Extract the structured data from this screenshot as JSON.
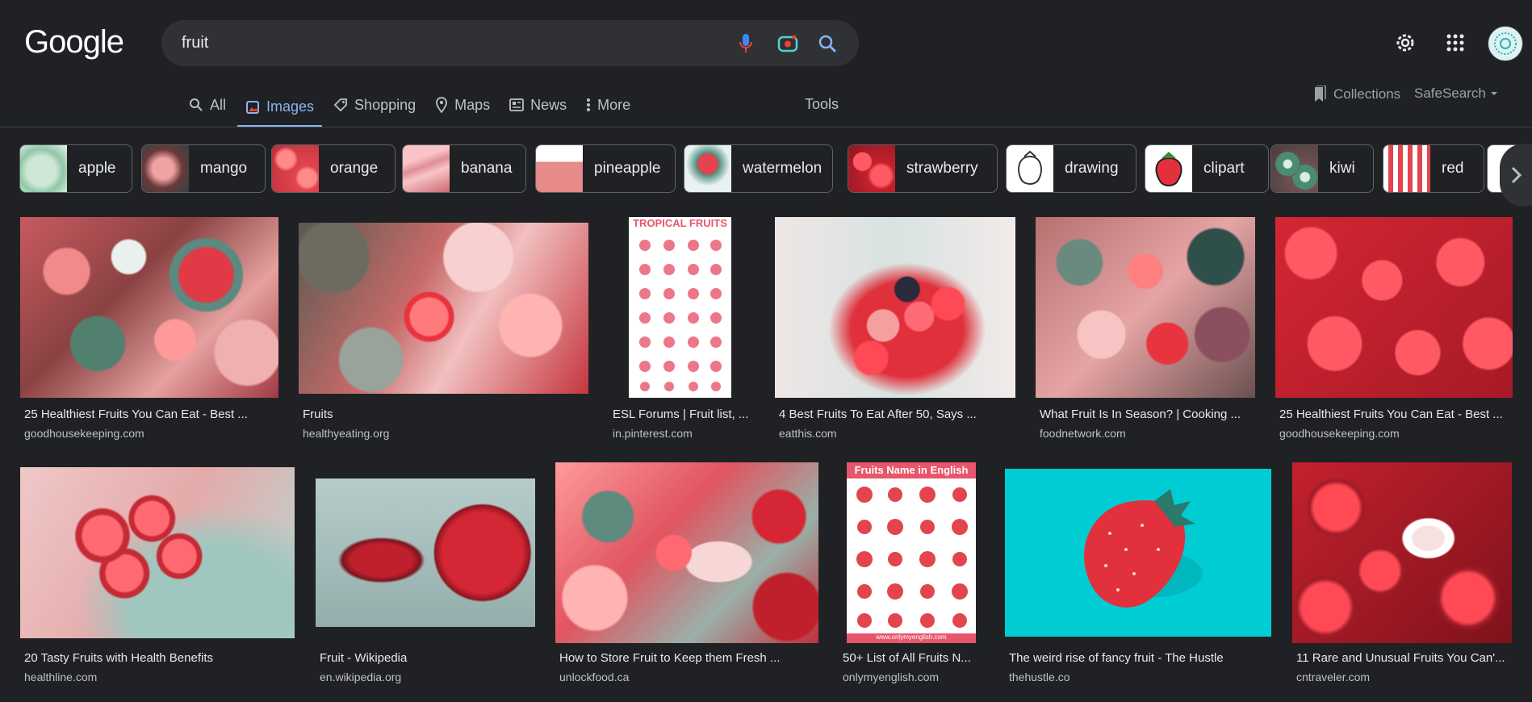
{
  "logo": "Google",
  "search": {
    "query": "fruit"
  },
  "tabs": [
    {
      "label": "All",
      "icon": "search-icon"
    },
    {
      "label": "Images",
      "icon": "image-icon"
    },
    {
      "label": "Shopping",
      "icon": "tag-icon"
    },
    {
      "label": "Maps",
      "icon": "pin-icon"
    },
    {
      "label": "News",
      "icon": "news-icon"
    },
    {
      "label": "More",
      "icon": "more-vert-icon"
    }
  ],
  "tools": "Tools",
  "collections": "Collections",
  "safesearch": "SafeSearch",
  "chips": [
    "apple",
    "mango",
    "orange",
    "banana",
    "pineapple",
    "watermelon",
    "strawberry",
    "drawing",
    "clipart",
    "kiwi",
    "red"
  ],
  "posters": {
    "tropical_title": "TROPICAL FRUITS",
    "english_title": "Fruits Name in English",
    "english_footer": "www.onlymyenglish.com"
  },
  "results": [
    {
      "title": "25 Healthiest Fruits You Can Eat - Best ...",
      "source": "goodhousekeeping.com"
    },
    {
      "title": "Fruits",
      "source": "healthyeating.org"
    },
    {
      "title": "ESL Forums | Fruit list, ...",
      "source": "in.pinterest.com"
    },
    {
      "title": "4 Best Fruits To Eat After 50, Says ...",
      "source": "eatthis.com"
    },
    {
      "title": "What Fruit Is In Season? | Cooking ...",
      "source": "foodnetwork.com"
    },
    {
      "title": "25 Healthiest Fruits You Can Eat - Best ...",
      "source": "goodhousekeeping.com"
    },
    {
      "title": "20 Tasty Fruits with Health Benefits",
      "source": "healthline.com"
    },
    {
      "title": "Fruit - Wikipedia",
      "source": "en.wikipedia.org"
    },
    {
      "title": "How to Store Fruit to Keep them Fresh ...",
      "source": "unlockfood.ca"
    },
    {
      "title": "50+ List of All Fruits N...",
      "source": "onlymyenglish.com"
    },
    {
      "title": "The weird rise of fancy fruit - The Hustle",
      "source": "thehustle.co"
    },
    {
      "title": "11 Rare and Unusual Fruits You Can'...",
      "source": "cntraveler.com"
    }
  ]
}
